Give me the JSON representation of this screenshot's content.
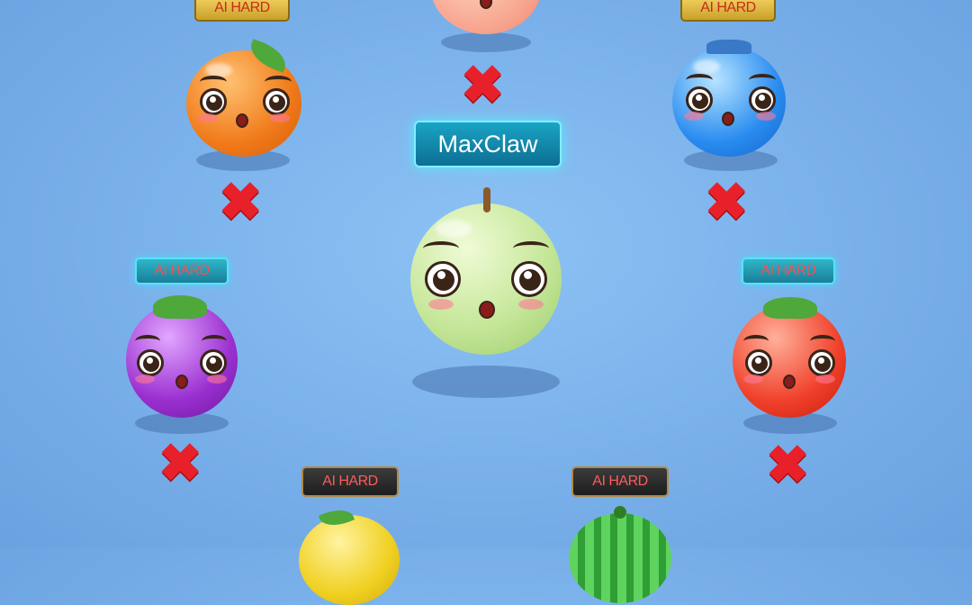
{
  "center_player": {
    "name": "MaxClaw"
  },
  "opponents": [
    {
      "id": "orange",
      "label": "AI HARD",
      "badge_style": "gold",
      "eliminated": true,
      "eliminated_mark": "✖"
    },
    {
      "id": "peach",
      "label": "",
      "badge_style": "gold",
      "eliminated": true,
      "eliminated_mark": "✖"
    },
    {
      "id": "blueberry",
      "label": "AI HARD",
      "badge_style": "gold",
      "eliminated": true,
      "eliminated_mark": "✖"
    },
    {
      "id": "grape",
      "label": "AI HARD",
      "badge_style": "teal",
      "eliminated": true,
      "eliminated_mark": "✖"
    },
    {
      "id": "tomato",
      "label": "AI HARD",
      "badge_style": "teal",
      "eliminated": true,
      "eliminated_mark": "✖"
    },
    {
      "id": "lemon",
      "label": "AI HARD",
      "badge_style": "dark",
      "eliminated": false
    },
    {
      "id": "watermelon",
      "label": "AI HARD",
      "badge_style": "dark",
      "eliminated": false
    }
  ],
  "colors": {
    "background": "#79b0ea",
    "player_green": "#c6e79a",
    "orange": "#f07a1a",
    "blueberry": "#2a8cf0",
    "grape": "#9a2fd0",
    "tomato": "#f0402a",
    "eliminated_x": "#e8202a"
  }
}
